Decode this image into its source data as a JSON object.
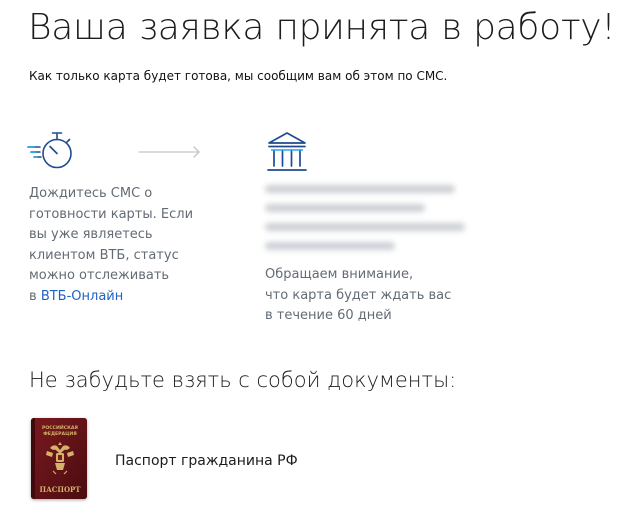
{
  "page": {
    "title": "Ваша заявка принята в работу!",
    "subtitle": "Как только карта будет готова, мы сообщим вам об этом по СМС."
  },
  "steps": {
    "sms": {
      "icon": "stopwatch-icon",
      "lines": [
        "Дождитесь СМС о",
        "готовности карты. Если",
        "вы уже являетесь",
        "клиентом ВТБ, статус",
        "можно отслеживать"
      ],
      "link_prefix": "в",
      "link_label": "ВТБ-Онлайн"
    },
    "connector": {
      "icon": "arrow-right-icon"
    },
    "branch": {
      "icon": "bank-icon",
      "notice_lines": [
        "Обращаем внимание,",
        "что карта будет ждать вас",
        "в течение 60 дней"
      ]
    }
  },
  "documents": {
    "title": "Не забудьте взять с собой документы:",
    "items": [
      {
        "label": "Паспорт гражданина РФ",
        "image": "passport-icon",
        "cover_lines": [
          "РОССИЙСКАЯ",
          "ФЕДЕРАЦИЯ"
        ],
        "cover_word": "ПАСПОРТ"
      }
    ]
  },
  "colors": {
    "accent": "#1e63c6",
    "icon": "#1e4b8f",
    "muted_text": "#636b75",
    "passport_cover": "#5c1116",
    "passport_gold": "#d4b26a"
  }
}
